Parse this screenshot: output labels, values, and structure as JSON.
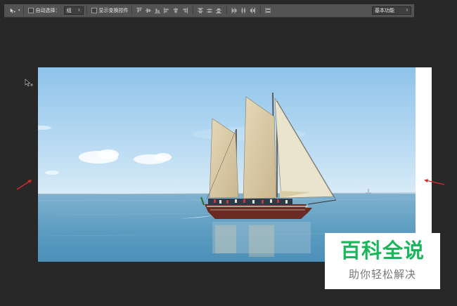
{
  "options_bar": {
    "auto_select_label": "自动选择：",
    "auto_select_value": "组",
    "show_transform_label": "显示变换控件",
    "workspace_value": "基本功能",
    "tool_icon": "move-tool-icon",
    "align_icons": [
      "align-top-edges-icon",
      "align-vertical-centers-icon",
      "align-bottom-edges-icon",
      "align-left-edges-icon",
      "align-horizontal-centers-icon",
      "align-right-edges-icon"
    ],
    "distribute_icons": [
      "distribute-top-icon",
      "distribute-vcenter-icon",
      "distribute-bottom-icon",
      "distribute-left-icon",
      "distribute-hcenter-icon",
      "distribute-right-icon"
    ],
    "extra_icon": "auto-align-icon"
  },
  "watermark": {
    "title": "百科全说",
    "subtitle": "助你轻松解决"
  },
  "colors": {
    "background": "#282828",
    "options_bar": "#535353",
    "annotation_arrow": "#d42a2a",
    "watermark_green": "#1bb55c"
  }
}
